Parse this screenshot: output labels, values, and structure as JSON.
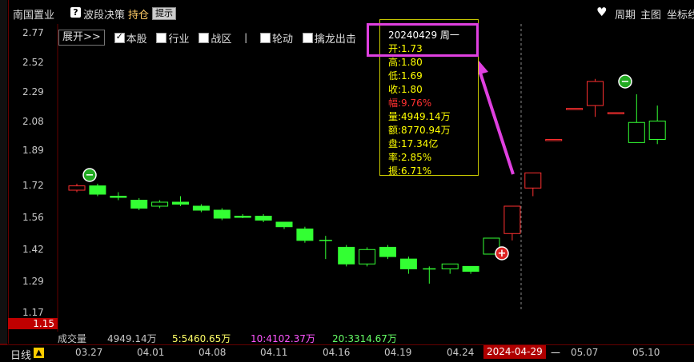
{
  "header": {
    "stock_name": "南国置业",
    "strategy": "波段决策",
    "holding": "持仓",
    "tip_badge": "提示",
    "right_items": [
      "周期",
      "主图",
      "坐标线"
    ]
  },
  "toolbar": {
    "expand": "展开>>",
    "checkboxes": [
      {
        "label": "本股",
        "checked": true
      },
      {
        "label": "行业",
        "checked": false
      },
      {
        "label": "战区",
        "checked": false
      },
      {
        "label": "轮动",
        "checked": false
      },
      {
        "label": "擒龙出击",
        "checked": false
      }
    ],
    "separator": "|"
  },
  "y_axis": [
    "2.77",
    "2.52",
    "2.29",
    "2.08",
    "1.89",
    "1.72",
    "1.56",
    "1.42",
    "1.29",
    "1.17"
  ],
  "price_marker": "1.15",
  "tooltip": {
    "date": "20240429 周一",
    "lines": [
      {
        "text": "开:1.73",
        "red": false
      },
      {
        "text": "高:1.80",
        "red": false
      },
      {
        "text": "低:1.69",
        "red": false
      },
      {
        "text": "收:1.80",
        "red": false
      },
      {
        "text": "幅:9.76%",
        "red": true
      },
      {
        "text": "量:4949.14万",
        "red": false
      },
      {
        "text": "额:8770.94万",
        "red": false
      },
      {
        "text": "盘:17.34亿",
        "red": false
      },
      {
        "text": "率:2.85%",
        "red": false
      },
      {
        "text": "振:6.71%",
        "red": false
      }
    ]
  },
  "volume": {
    "label": "成交量",
    "value": "4949.14万",
    "ma5": "5:5460.65万",
    "ma10": "10:4102.37万",
    "ma20": "20:3314.67万",
    "colors": {
      "label": "#c8c8c8",
      "ma5": "#ffff66",
      "ma10": "#ff55ff",
      "ma20": "#66ff66"
    }
  },
  "period": "日线",
  "dates": [
    "03.27",
    "04.01",
    "04.08",
    "04.11",
    "04.16",
    "04.19",
    "04.24",
    "05.07",
    "05.10"
  ],
  "selected_date": "2024-04-29",
  "chart_data": {
    "type": "candlestick",
    "ylim": [
      1.17,
      2.77
    ],
    "candles": [
      {
        "o": 1.74,
        "h": 1.75,
        "l": 1.71,
        "c": 1.72,
        "dir": "up"
      },
      {
        "o": 1.74,
        "h": 1.75,
        "l": 1.69,
        "c": 1.7,
        "dir": "down"
      },
      {
        "o": 1.69,
        "h": 1.71,
        "l": 1.67,
        "c": 1.69,
        "dir": "down"
      },
      {
        "o": 1.67,
        "h": 1.68,
        "l": 1.62,
        "c": 1.63,
        "dir": "down"
      },
      {
        "o": 1.66,
        "h": 1.67,
        "l": 1.63,
        "c": 1.64,
        "dir": "down-hollow"
      },
      {
        "o": 1.66,
        "h": 1.69,
        "l": 1.64,
        "c": 1.65,
        "dir": "down"
      },
      {
        "o": 1.64,
        "h": 1.65,
        "l": 1.61,
        "c": 1.62,
        "dir": "down"
      },
      {
        "o": 1.62,
        "h": 1.63,
        "l": 1.57,
        "c": 1.58,
        "dir": "down"
      },
      {
        "o": 1.59,
        "h": 1.6,
        "l": 1.58,
        "c": 1.59,
        "dir": "down"
      },
      {
        "o": 1.59,
        "h": 1.6,
        "l": 1.56,
        "c": 1.57,
        "dir": "down"
      },
      {
        "o": 1.56,
        "h": 1.56,
        "l": 1.53,
        "c": 1.54,
        "dir": "down"
      },
      {
        "o": 1.53,
        "h": 1.54,
        "l": 1.47,
        "c": 1.48,
        "dir": "down"
      },
      {
        "o": 1.48,
        "h": 1.5,
        "l": 1.4,
        "c": 1.47,
        "dir": "down-thin"
      },
      {
        "o": 1.45,
        "h": 1.46,
        "l": 1.37,
        "c": 1.38,
        "dir": "down"
      },
      {
        "o": 1.38,
        "h": 1.45,
        "l": 1.37,
        "c": 1.44,
        "dir": "down-hollow"
      },
      {
        "o": 1.45,
        "h": 1.46,
        "l": 1.4,
        "c": 1.41,
        "dir": "down"
      },
      {
        "o": 1.4,
        "h": 1.41,
        "l": 1.34,
        "c": 1.36,
        "dir": "down"
      },
      {
        "o": 1.36,
        "h": 1.37,
        "l": 1.3,
        "c": 1.35,
        "dir": "down-thin"
      },
      {
        "o": 1.36,
        "h": 1.38,
        "l": 1.34,
        "c": 1.38,
        "dir": "down-hollow"
      },
      {
        "o": 1.37,
        "h": 1.37,
        "l": 1.34,
        "c": 1.35,
        "dir": "down"
      },
      {
        "o": 1.42,
        "h": 1.49,
        "l": 1.42,
        "c": 1.49,
        "dir": "down-hollow"
      },
      {
        "o": 1.51,
        "h": 1.64,
        "l": 1.48,
        "c": 1.64,
        "dir": "up"
      },
      {
        "o": 1.73,
        "h": 1.8,
        "l": 1.69,
        "c": 1.8,
        "dir": "up"
      },
      {
        "o": 1.98,
        "h": 1.98,
        "l": 1.98,
        "c": 1.98,
        "dir": "up"
      },
      {
        "o": 2.19,
        "h": 2.19,
        "l": 2.19,
        "c": 2.19,
        "dir": "up"
      },
      {
        "o": 2.21,
        "h": 2.41,
        "l": 2.13,
        "c": 2.39,
        "dir": "up"
      },
      {
        "o": 2.16,
        "h": 2.16,
        "l": 2.16,
        "c": 2.16,
        "dir": "up"
      },
      {
        "o": 2.09,
        "h": 2.29,
        "l": 1.96,
        "c": 1.96,
        "dir": "down-hollow"
      },
      {
        "o": 2.1,
        "h": 2.21,
        "l": 1.95,
        "c": 1.98,
        "dir": "down-hollow"
      }
    ]
  }
}
